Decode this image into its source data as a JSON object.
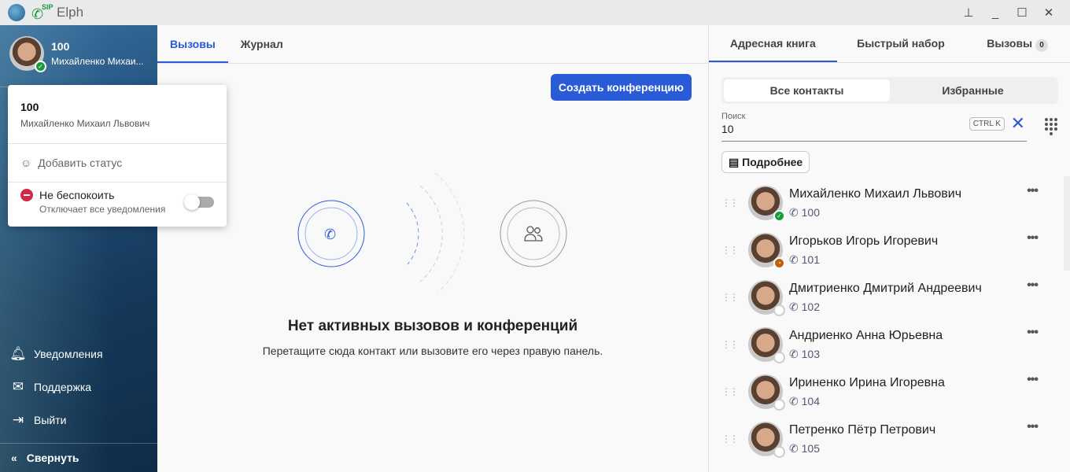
{
  "app": {
    "title": "Elph",
    "sip_label": "SIP"
  },
  "user": {
    "extension": "100",
    "name_short": "Михайленко Михаи...",
    "name": "Михайленко Михаил Львович"
  },
  "popup": {
    "add_status": "Добавить статус",
    "dnd_title": "Не беспокоить",
    "dnd_sub": "Отключает все уведомления",
    "dnd_on": false
  },
  "sidebar": {
    "items": [
      {
        "label": "Уведомления",
        "icon": "bell-icon"
      },
      {
        "label": "Поддержка",
        "icon": "mail-icon"
      },
      {
        "label": "Выйти",
        "icon": "logout-icon"
      }
    ],
    "collapse": "Свернуть"
  },
  "main": {
    "tabs": [
      "Вызовы",
      "Журнал"
    ],
    "create_conference": "Создать конференцию",
    "empty_title": "Нет активных вызовов и конференций",
    "empty_sub": "Перетащите сюда контакт или вызовите его через правую панель."
  },
  "right": {
    "tabs": [
      "Адресная книга",
      "Быстрый набор",
      "Вызовы"
    ],
    "calls_count": "0",
    "segments": [
      "Все контакты",
      "Избранные"
    ],
    "search_label": "Поиск",
    "search_value": "10",
    "shortcut": "CTRL K",
    "details": "Подробнее",
    "contacts": [
      {
        "name": "Михайленко Михаил Львович",
        "ext": "100",
        "status": "online"
      },
      {
        "name": "Игорьков Игорь Игоревич",
        "ext": "101",
        "status": "away"
      },
      {
        "name": "Дмитриенко Дмитрий Андреевич",
        "ext": "102",
        "status": "offline"
      },
      {
        "name": "Андриенко Анна Юрьевна",
        "ext": "103",
        "status": "offline"
      },
      {
        "name": "Ириненко Ирина Игоревна",
        "ext": "104",
        "status": "offline"
      },
      {
        "name": "Петренко Пётр Петрович",
        "ext": "105",
        "status": "offline"
      }
    ]
  }
}
